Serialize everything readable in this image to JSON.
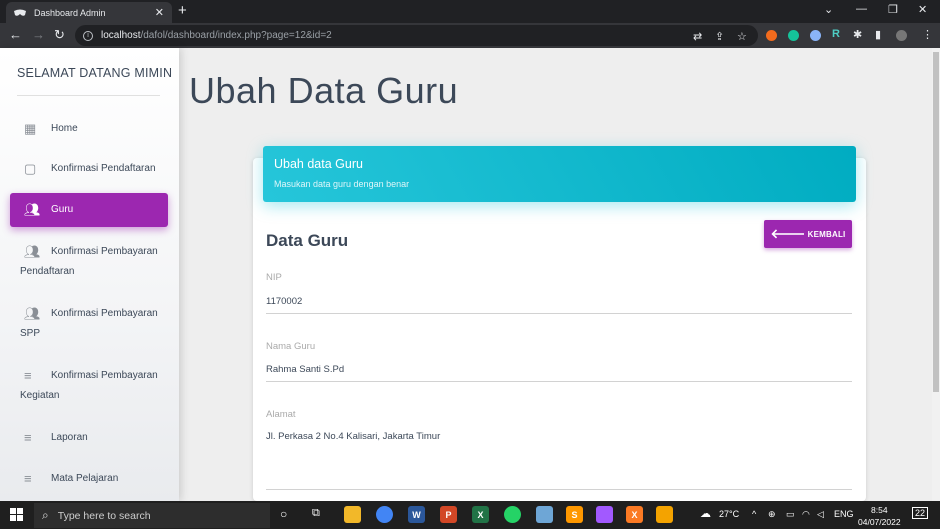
{
  "browser": {
    "tab_title": "Dashboard Admin",
    "url_host": "localhost",
    "url_path": "/dafol/dashboard/index.php?page=12&id=2"
  },
  "sidebar": {
    "brand": "SELAMAT DATANG MIMIN",
    "items": [
      {
        "label": "Home",
        "icon": "dashboard-icon"
      },
      {
        "label": "Konfirmasi Pendaftaran",
        "icon": "clipboard-icon"
      },
      {
        "label": "Guru",
        "icon": "people-icon",
        "active": true
      },
      {
        "label": "Konfirmasi Pembayaran",
        "label2": "Pendaftaran",
        "icon": "people-icon"
      },
      {
        "label": "Konfirmasi Pembayaran",
        "label2": "SPP",
        "icon": "people-icon"
      },
      {
        "label": "Konfirmasi Pembayaran",
        "label2": "Kegiatan",
        "icon": "list-icon"
      },
      {
        "label": "Laporan",
        "icon": "list-icon"
      },
      {
        "label": "Mata Pelajaran",
        "icon": "list-icon"
      }
    ]
  },
  "main": {
    "page_title": "Ubah Data Guru",
    "card_header_title": "Ubah data Guru",
    "card_header_subtitle": "Masukan data guru dengan benar",
    "section_title": "Data Guru",
    "back_button": "KEMBALI",
    "fields": [
      {
        "label": "NIP",
        "value": "1170002"
      },
      {
        "label": "Nama Guru",
        "value": "Rahma Santi S.Pd"
      },
      {
        "label": "Alamat",
        "value": "Jl. Perkasa 2 No.4 Kalisari, Jakarta Timur"
      }
    ]
  },
  "taskbar": {
    "search_placeholder": "Type here to search",
    "weather": "27°C",
    "language": "ENG",
    "time": "8:54",
    "date": "04/07/2022",
    "notifications": "22"
  },
  "colors": {
    "accent_purple": "#9c27b0",
    "header_cyan": "#00bcd4"
  }
}
